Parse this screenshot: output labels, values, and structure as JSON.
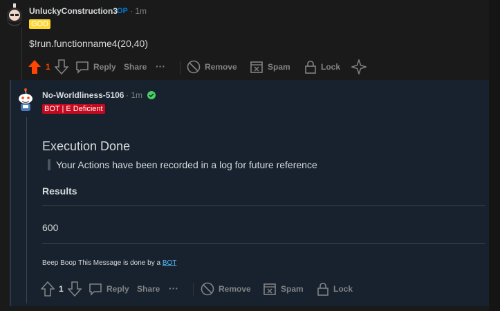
{
  "comment_op": {
    "author": "UnluckyConstruction3",
    "op_badge": "OP",
    "time": "· 1m",
    "flair": "GOD",
    "text": "$!run.functionname4(20,40)",
    "score": "1",
    "actions": {
      "reply": "Reply",
      "share": "Share",
      "more": "···",
      "remove": "Remove",
      "spam": "Spam",
      "lock": "Lock"
    },
    "icons": [
      "upvote-icon",
      "downvote-icon",
      "reply-icon",
      "more-icon",
      "remove-icon",
      "spam-icon",
      "lock-icon",
      "sparkle-icon"
    ],
    "colors": {
      "upvote": "#ff4500",
      "flair": "#ffd635"
    }
  },
  "comment_bot": {
    "author": "No-Worldliness-5106",
    "time": "· 1m",
    "flair": "BOT | E Deficient",
    "heading": "Execution Done",
    "quote": "Your Actions have been recorded in a log for future reference",
    "results_label": "Results",
    "results_value": "600",
    "footer_prefix": "Beep Boop This Message is done by a ",
    "footer_link": "BOT",
    "score": "1",
    "actions": {
      "reply": "Reply",
      "share": "Share",
      "more": "···",
      "remove": "Remove",
      "spam": "Spam",
      "lock": "Lock"
    },
    "colors": {
      "verified": "#46d160",
      "flair": "#c4091f",
      "link": "#4fbcff"
    }
  }
}
